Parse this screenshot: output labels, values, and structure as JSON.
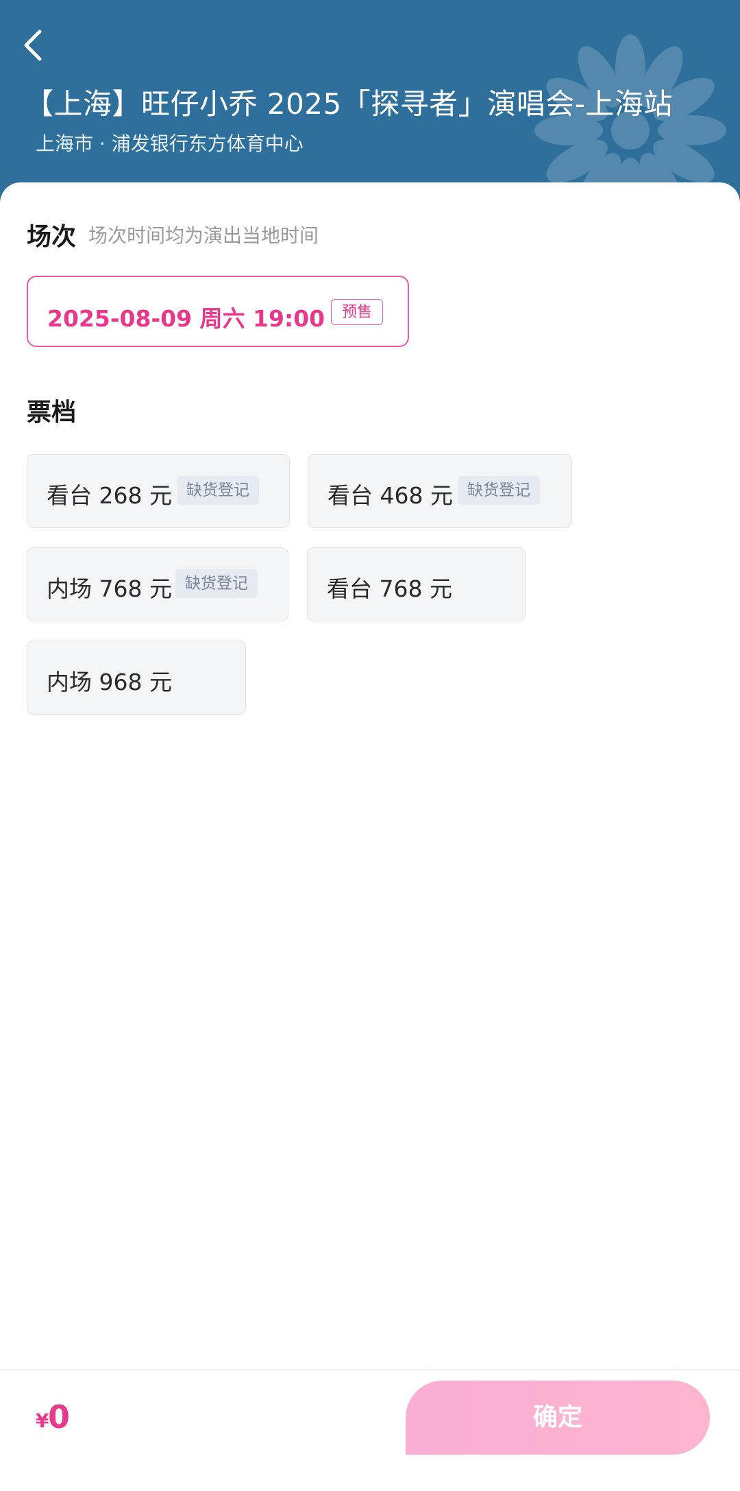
{
  "header": {
    "title": "【上海】旺仔小乔 2025「探寻者」演唱会-上海站",
    "venue": "上海市 · 浦发银行东方体育中心",
    "back_icon": "chevron-left-icon",
    "background_color": "#2e6f9b"
  },
  "session_section": {
    "title": "场次",
    "hint": "场次时间均为演出当地时间",
    "selected_session": {
      "datetime": "2025-08-09  周六 19:00",
      "badge": "预售"
    }
  },
  "ticket_section": {
    "title": "票档",
    "tiers": [
      {
        "label": "看台 268 元",
        "badge": "缺货登记"
      },
      {
        "label": "看台 468 元",
        "badge": "缺货登记"
      },
      {
        "label": "内场 768 元",
        "badge": "缺货登记"
      },
      {
        "label": "看台 768 元",
        "badge": ""
      },
      {
        "label": "内场 968 元",
        "badge": ""
      }
    ]
  },
  "footer": {
    "currency_symbol": "¥",
    "total": "0",
    "confirm_label": "确定"
  },
  "colors": {
    "accent": "#e8388a",
    "button_gradient_start": "#fbaed3",
    "button_gradient_end": "#fdb4cf"
  }
}
